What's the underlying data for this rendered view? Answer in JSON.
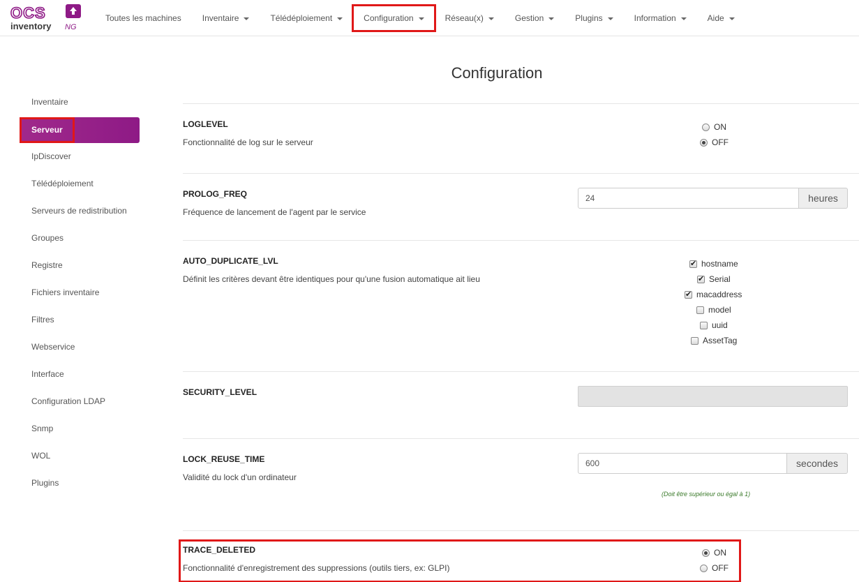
{
  "brand": {
    "logo_top": "OCS",
    "logo_bottom": "inventory",
    "logo_suffix": "NG",
    "accent": "#8e1a86"
  },
  "nav": {
    "items": [
      {
        "label": "Toutes les machines",
        "dropdown": false
      },
      {
        "label": "Inventaire",
        "dropdown": true
      },
      {
        "label": "Télédéploiement",
        "dropdown": true
      },
      {
        "label": "Configuration",
        "dropdown": true
      },
      {
        "label": "Réseau(x)",
        "dropdown": true
      },
      {
        "label": "Gestion",
        "dropdown": true
      },
      {
        "label": "Plugins",
        "dropdown": true
      },
      {
        "label": "Information",
        "dropdown": true
      },
      {
        "label": "Aide",
        "dropdown": true
      }
    ]
  },
  "page": {
    "title": "Configuration"
  },
  "sidebar": {
    "items": [
      {
        "label": "Inventaire"
      },
      {
        "label": "Serveur",
        "active": true
      },
      {
        "label": "IpDiscover"
      },
      {
        "label": "Télédéploiement"
      },
      {
        "label": "Serveurs de redistribution"
      },
      {
        "label": "Groupes"
      },
      {
        "label": "Registre"
      },
      {
        "label": "Fichiers inventaire"
      },
      {
        "label": "Filtres"
      },
      {
        "label": "Webservice"
      },
      {
        "label": "Interface"
      },
      {
        "label": "Configuration LDAP"
      },
      {
        "label": "Snmp"
      },
      {
        "label": "WOL"
      },
      {
        "label": "Plugins"
      }
    ]
  },
  "settings": {
    "loglevel": {
      "label": "LOGLEVEL",
      "desc": "Fonctionnalité de log sur le serveur",
      "on_label": "ON",
      "off_label": "OFF",
      "value": "OFF"
    },
    "prolog_freq": {
      "label": "PROLOG_FREQ",
      "desc": "Fréquence de lancement de l'agent par le service",
      "value": "24",
      "unit": "heures"
    },
    "auto_duplicate": {
      "label": "AUTO_DUPLICATE_LVL",
      "desc": "Définit les critères devant être identiques pour qu'une fusion automatique ait lieu",
      "options": [
        {
          "label": "hostname",
          "checked": true
        },
        {
          "label": "Serial",
          "checked": true
        },
        {
          "label": "macaddress",
          "checked": true
        },
        {
          "label": "model",
          "checked": false
        },
        {
          "label": "uuid",
          "checked": false
        },
        {
          "label": "AssetTag",
          "checked": false
        }
      ]
    },
    "security_level": {
      "label": "SECURITY_LEVEL",
      "value": ""
    },
    "lock_reuse_time": {
      "label": "LOCK_REUSE_TIME",
      "desc": "Validité du lock d'un ordinateur",
      "value": "600",
      "unit": "secondes",
      "hint": "(Doit être supérieur ou égal à 1)"
    },
    "trace_deleted": {
      "label": "TRACE_DELETED",
      "desc": "Fonctionnalité d'enregistrement des suppressions (outils tiers, ex: GLPI)",
      "on_label": "ON",
      "off_label": "OFF",
      "value": "ON"
    }
  }
}
